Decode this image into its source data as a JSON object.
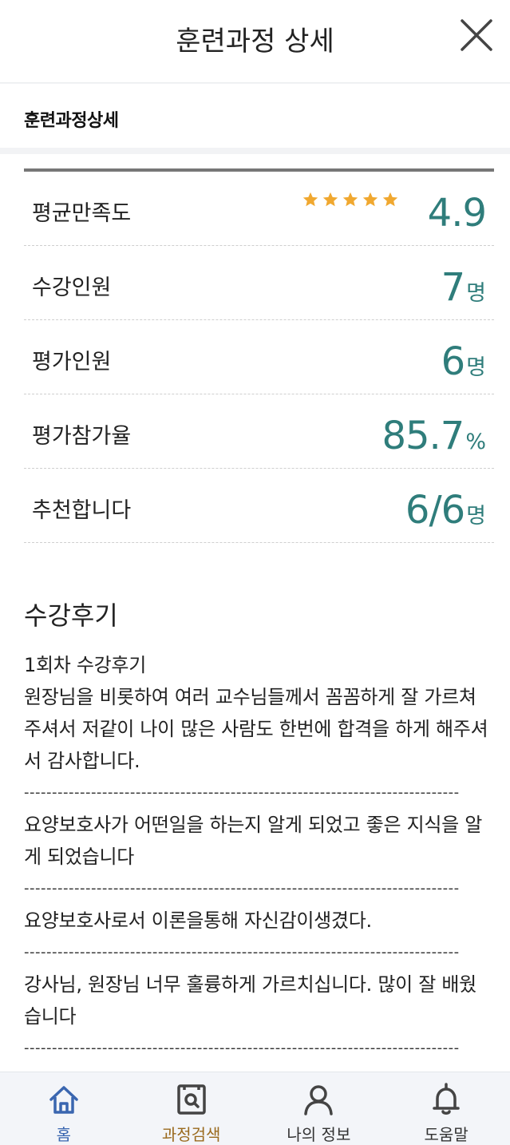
{
  "header": {
    "title": "훈련과정 상세"
  },
  "section": {
    "title": "훈련과정상세"
  },
  "stats": {
    "satisfaction": {
      "label": "평균만족도",
      "value": "4.9",
      "stars": 5
    },
    "enrolled": {
      "label": "수강인원",
      "value": "7",
      "unit": "명"
    },
    "evaluators": {
      "label": "평가인원",
      "value": "6",
      "unit": "명"
    },
    "participation": {
      "label": "평가참가율",
      "value": "85.7",
      "unit": "%"
    },
    "recommend": {
      "label": "추천합니다",
      "value": "6/6",
      "unit": "명"
    }
  },
  "reviews": {
    "title": "수강후기",
    "items": [
      "1회차 수강후기",
      "원장님을 비롯하여 여러 교수님들께서 꼼꼼하게 잘 가르쳐주셔서 저같이 나이 많은 사람도 한번에 합격을 하게 해주셔서 감사합니다.",
      "------------------------------------------------------------------------------",
      " 요양보호사가 어떤일을 하는지 알게 되었고 좋은 지식을 알게 되었습니다",
      "------------------------------------------------------------------------------",
      "요양보호사로서 이론을통해 자신감이생겼다.",
      "------------------------------------------------------------------------------",
      "강사님, 원장님 너무 훌륭하게 가르치십니다. 많이 잘 배웠습니다",
      "------------------------------------------------------------------------------"
    ]
  },
  "nav": {
    "home": "홈",
    "search": "과정검색",
    "myinfo": "나의 정보",
    "help": "도움말"
  },
  "colors": {
    "accent_teal": "#2f7d7b",
    "star_gold": "#f0a830",
    "nav_home": "#3a66b0",
    "nav_search_active": "#9a6a1e"
  }
}
